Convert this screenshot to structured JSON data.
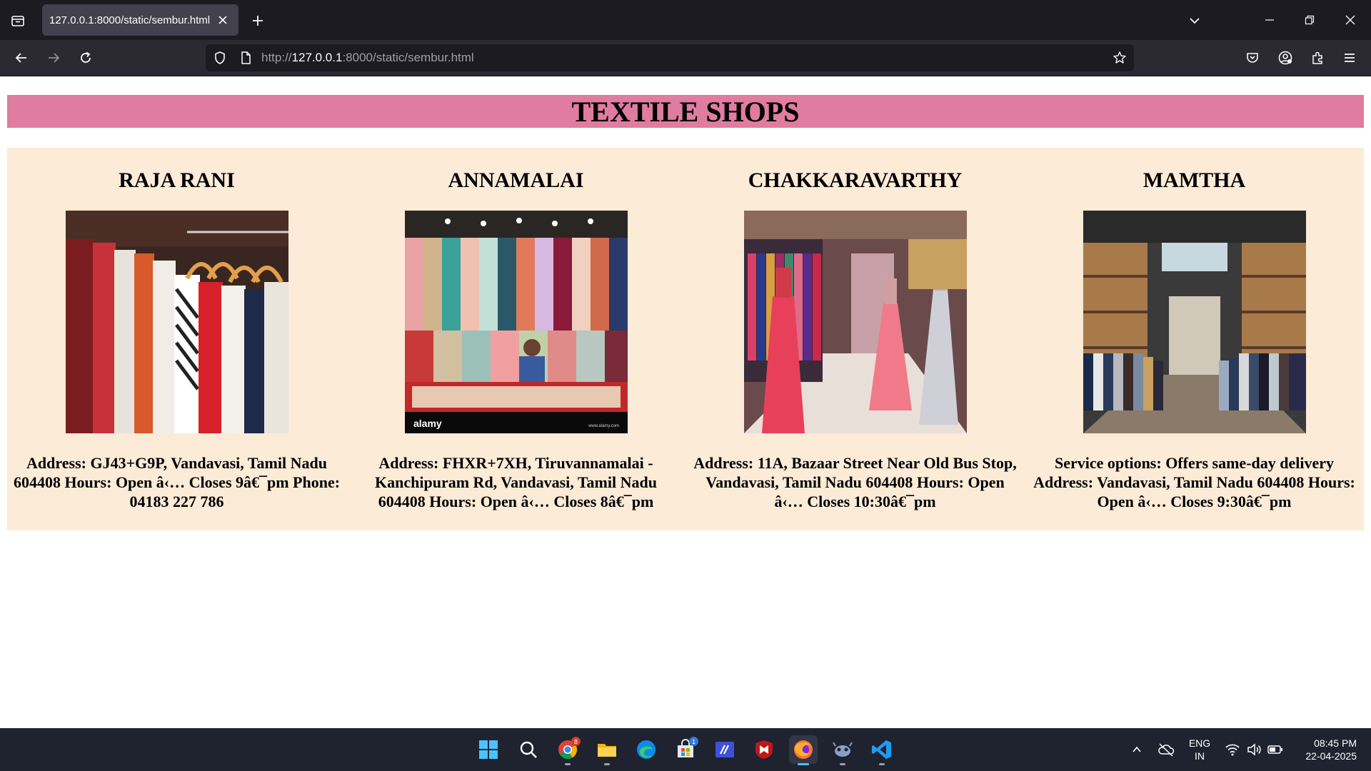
{
  "browser": {
    "tab_title": "127.0.0.1:8000/static/sembur.html",
    "url_prefix": "http://",
    "url_host": "127.0.0.1",
    "url_rest": ":8000/static/sembur.html"
  },
  "page": {
    "banner_title": "TEXTILE SHOPS",
    "shops": [
      {
        "name": "RAJA RANI",
        "details": "Address: GJ43+G9P, Vandavasi, Tamil Nadu 604408 Hours: Open â‹… Closes 9â€¯pm Phone: 04183 227 786"
      },
      {
        "name": "ANNAMALAI",
        "details": "Address: FHXR+7XH, Tiruvannamalai - Kanchipuram Rd, Vandavasi, Tamil Nadu 604408 Hours: Open â‹… Closes 8â€¯pm"
      },
      {
        "name": "CHAKKARAVARTHY",
        "details": "Address: 11A, Bazaar Street Near Old Bus Stop, Vandavasi, Tamil Nadu 604408 Hours: Open â‹… Closes 10:30â€¯pm"
      },
      {
        "name": "MAMTHA",
        "details": "Service options: Offers same-day delivery Address: Vandavasi, Tamil Nadu 604408 Hours: Open â‹… Closes 9:30â€¯pm"
      }
    ],
    "image_watermark": "alamy",
    "image_watermark_url": "www.alamy.com"
  },
  "taskbar": {
    "language": "ENG",
    "region": "IN",
    "time": "08:45 PM",
    "date": "22-04-2025",
    "chrome_badge": "8",
    "store_badge": "1",
    "icons": [
      "windows-start-icon",
      "search-icon",
      "chrome-icon",
      "file-explorer-icon",
      "edge-icon",
      "microsoft-store-icon",
      "code-app-icon",
      "mcafee-icon",
      "firefox-icon",
      "app-icon",
      "vscode-icon"
    ]
  },
  "colors": {
    "banner": "#e07ca0",
    "shop_panel": "#fbebd7",
    "tab_active": "#42414d",
    "tabbar": "#1c1b22",
    "navbar": "#2b2a33",
    "taskbar": "#1f2330",
    "taskbar_active_indicator": "#4cc2ff"
  }
}
